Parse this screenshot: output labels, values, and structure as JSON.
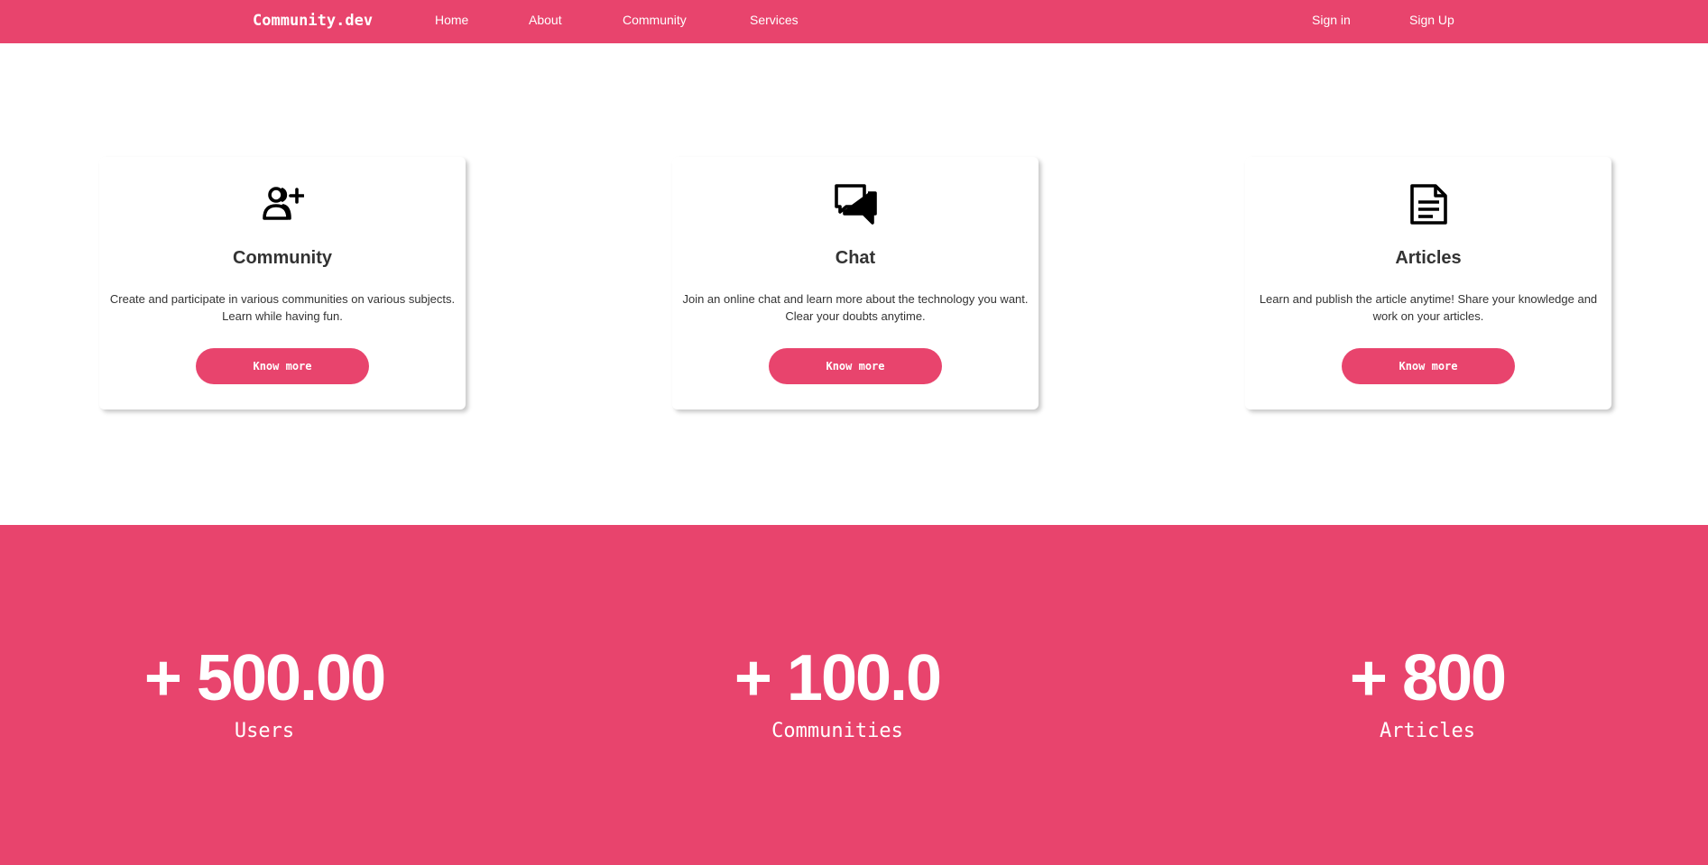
{
  "navbar": {
    "brand": "Community.dev",
    "links": [
      "Home",
      "About",
      "Community",
      "Services"
    ],
    "auth": [
      "Sign in",
      "Sign Up"
    ]
  },
  "cards": [
    {
      "icon": "add-user-icon",
      "title": "Community",
      "description": "Create and participate in various communities on various subjects. Learn while having fun.",
      "button": "Know more"
    },
    {
      "icon": "chat-icon",
      "title": "Chat",
      "description": "Join an online chat and learn more about the technology you want. Clear your doubts anytime.",
      "button": "Know more"
    },
    {
      "icon": "article-icon",
      "title": "Articles",
      "description": "Learn and publish the article anytime! Share your knowledge and work on your articles.",
      "button": "Know more"
    }
  ],
  "stats": [
    {
      "value": "+ 500.00",
      "label": "Users"
    },
    {
      "value": "+ 100.0",
      "label": "Communities"
    },
    {
      "value": "+ 800",
      "label": "Articles"
    }
  ],
  "colors": {
    "accent": "#E8446D",
    "text": "#333333",
    "background": "#FFFFFF"
  }
}
